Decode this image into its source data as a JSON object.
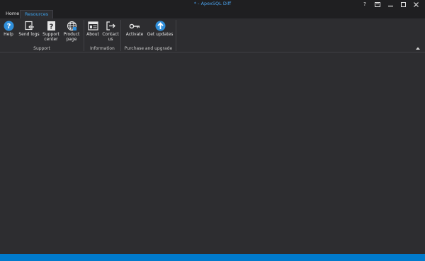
{
  "window": {
    "title": "* - ApexSQL Diff",
    "controls": [
      "help-icon",
      "restore-layout-icon",
      "minimize-icon",
      "maximize-icon",
      "close-icon"
    ]
  },
  "tabs": [
    {
      "label": "Home",
      "active": false
    },
    {
      "label": "Resources",
      "active": true
    }
  ],
  "ribbon": {
    "groups": [
      {
        "label": "Support",
        "buttons": [
          {
            "label": "Help",
            "icon": "help-icon"
          },
          {
            "label": "Send logs",
            "icon": "send-logs-icon"
          },
          {
            "label": "Support\ncenter",
            "icon": "support-center-icon"
          },
          {
            "label": "Product\npage",
            "icon": "globe-icon"
          }
        ]
      },
      {
        "label": "Information",
        "buttons": [
          {
            "label": "About",
            "icon": "about-icon"
          },
          {
            "label": "Contact\nus",
            "icon": "contact-icon"
          }
        ]
      },
      {
        "label": "Purchase and upgrade",
        "buttons": [
          {
            "label": "Activate",
            "icon": "key-icon"
          },
          {
            "label": "Get updates",
            "icon": "update-arrow-icon"
          }
        ]
      }
    ]
  },
  "colors": {
    "accent": "#007acc",
    "tab_active_text": "#3c9fe8",
    "background": "#2d2d30",
    "titlebar": "#1f1f21"
  }
}
